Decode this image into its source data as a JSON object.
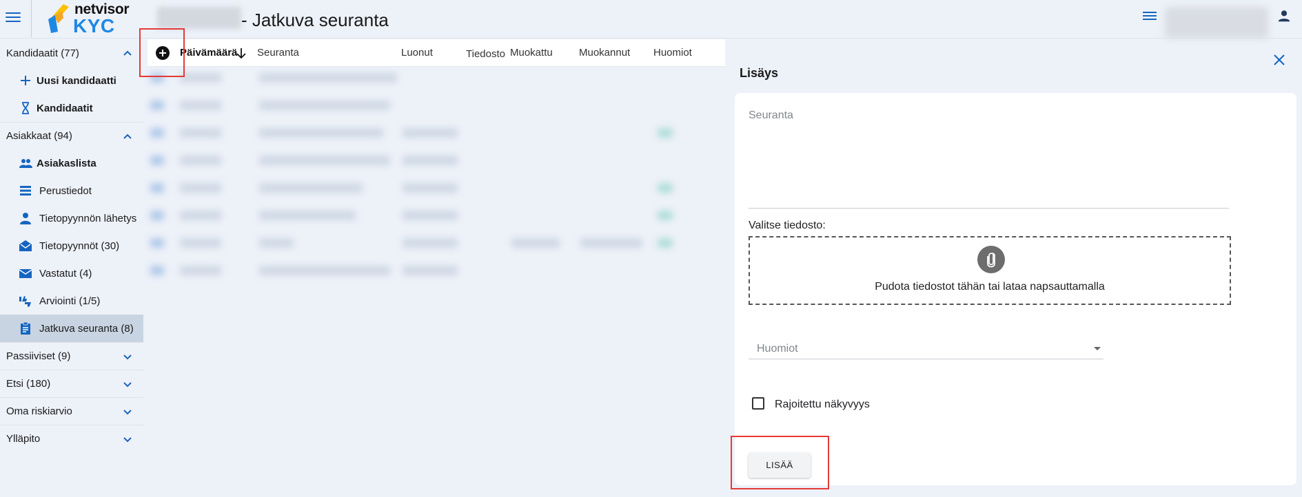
{
  "header": {
    "brand_top": "netvisor",
    "brand_bottom": "KYC",
    "page_title": "- Jatkuva seuranta"
  },
  "sidebar": {
    "groups": [
      {
        "label": "Kandidaatit (77)",
        "expanded": true,
        "items": [
          {
            "label": "Uusi kandidaatti",
            "icon": "plus-icon"
          },
          {
            "label": "Kandidaatit",
            "icon": "hourglass-icon"
          }
        ]
      },
      {
        "label": "Asiakkaat (94)",
        "expanded": true,
        "items": [
          {
            "label": "Asiakaslista",
            "icon": "people-icon"
          },
          {
            "label": "Perustiedot",
            "icon": "list-icon"
          },
          {
            "label": "Tietopyynnön lähetys",
            "icon": "person-icon"
          },
          {
            "label": "Tietopyynnöt (30)",
            "icon": "open-mail-icon"
          },
          {
            "label": "Vastatut (4)",
            "icon": "mail-icon"
          },
          {
            "label": "Arviointi (1/5)",
            "icon": "thumbs-icon"
          },
          {
            "label": "Jatkuva seuranta (8)",
            "icon": "clipboard-icon"
          }
        ]
      },
      {
        "label": "Passiiviset (9)",
        "expanded": false
      },
      {
        "label": "Etsi (180)",
        "expanded": false
      },
      {
        "label": "Oma riskiarvio",
        "expanded": false
      },
      {
        "label": "Ylläpito",
        "expanded": false
      }
    ]
  },
  "table": {
    "columns": [
      "Päivämäärä",
      "Seuranta",
      "Luonut",
      "Tiedosto",
      "Muokattu",
      "Muokannut",
      "Huomiot"
    ],
    "sorted_column": "Päivämäärä",
    "sort_direction": "descending"
  },
  "panel": {
    "title": "Lisäys",
    "seuranta_placeholder": "Seuranta",
    "file_label": "Valitse tiedosto:",
    "dropzone_text": "Pudota tiedostot tähän tai lataa napsauttamalla",
    "huomiot_placeholder": "Huomiot",
    "checkbox_label": "Rajoitettu näkyvyys",
    "checkbox_checked": false,
    "submit_label": "LISÄÄ"
  },
  "colors": {
    "accent": "#1565c0",
    "highlight": "#e53935",
    "active_nav": "#c9d4e2"
  }
}
